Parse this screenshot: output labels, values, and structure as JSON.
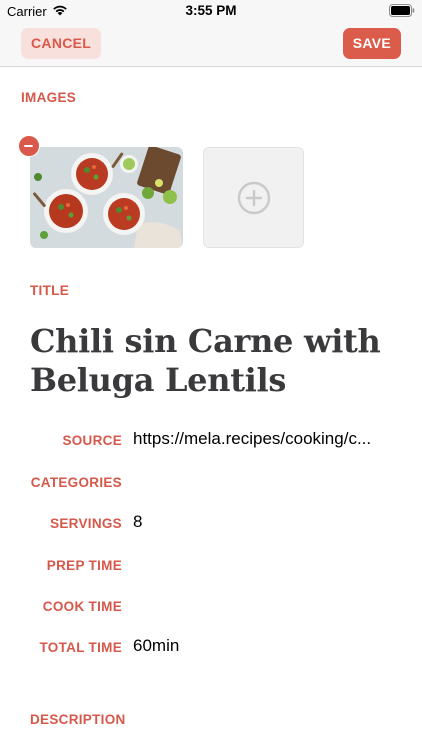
{
  "status_bar": {
    "carrier": "Carrier",
    "time": "3:55 PM"
  },
  "nav": {
    "cancel_label": "CANCEL",
    "save_label": "SAVE"
  },
  "sections": {
    "images_label": "IMAGES",
    "title_label": "TITLE",
    "description_label": "DESCRIPTION"
  },
  "recipe": {
    "title": "Chili sin Carne with Beluga Lentils"
  },
  "fields": {
    "source": {
      "label": "SOURCE",
      "value": "https://mela.recipes/cooking/c..."
    },
    "categories": {
      "label": "CATEGORIES",
      "value": ""
    },
    "servings": {
      "label": "SERVINGS",
      "value": "8"
    },
    "prep_time": {
      "label": "PREP TIME",
      "value": ""
    },
    "cook_time": {
      "label": "COOK TIME",
      "value": ""
    },
    "total_time": {
      "label": "TOTAL TIME",
      "value": "60min"
    }
  },
  "colors": {
    "accent": "#dc5c4b",
    "accent_light": "#f8e1dd",
    "label": "#d6584a",
    "title_text": "#3a3a3c"
  },
  "icons": {
    "wifi": "wifi-icon",
    "battery": "battery-icon",
    "remove": "minus-circle-icon",
    "add": "plus-circle-icon"
  }
}
